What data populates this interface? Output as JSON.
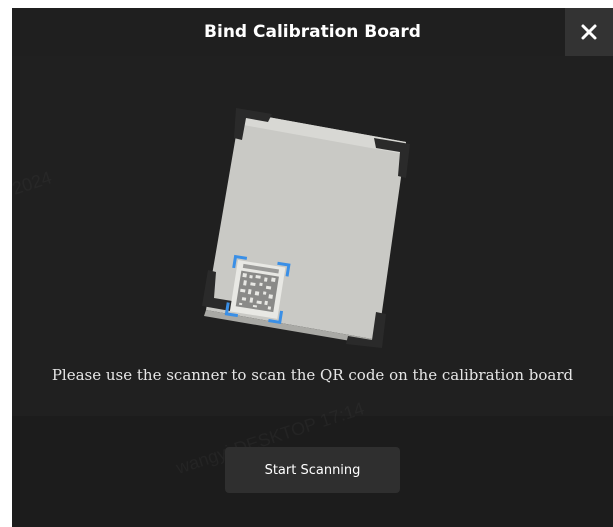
{
  "dialog": {
    "title": "Bind Calibration Board",
    "close_icon": "close-icon",
    "instruction": "Please use the scanner to scan the QR code on the calibration board",
    "start_button_label": "Start Scanning"
  },
  "illustration": {
    "name": "calibration-board-with-qr-code",
    "qr_label": "CALIBRATION"
  },
  "colors": {
    "background": "#1c1c1c",
    "header": "#1f1f1f",
    "close_button": "#333333",
    "button": "#2f2f2f",
    "text": "#ffffff",
    "qr_frame": "#3a8fe6"
  }
}
